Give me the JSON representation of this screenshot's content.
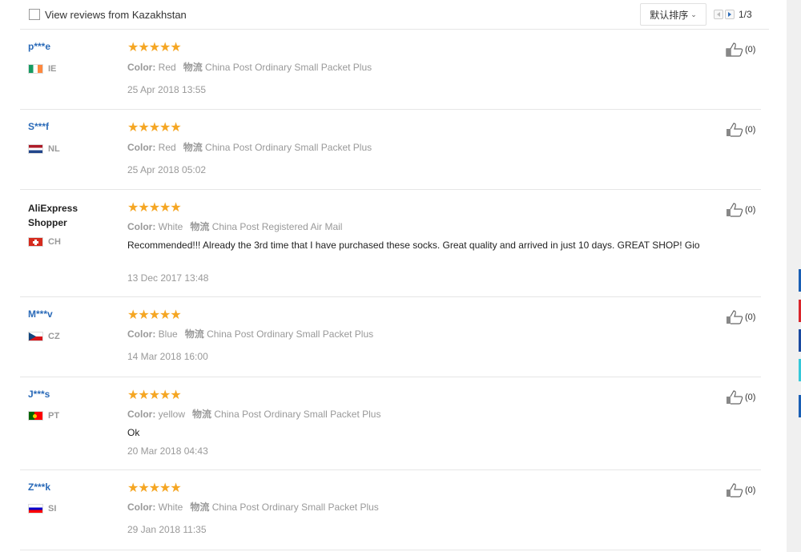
{
  "toolbar": {
    "filter_label": "View reviews from Kazakhstan",
    "sort_label": "默认排序",
    "page": "1/3"
  },
  "labels": {
    "color": "Color:",
    "shipping": "物流"
  },
  "reviews": [
    {
      "user": "p***e",
      "country": "IE",
      "stars": "★★★★★",
      "color": "Red",
      "shipping": "China Post Ordinary Small Packet Plus",
      "text": "",
      "date": "25 Apr 2018 13:55",
      "helpful": "(0)"
    },
    {
      "user": "S***f",
      "country": "NL",
      "stars": "★★★★★",
      "color": "Red",
      "shipping": "China Post Ordinary Small Packet Plus",
      "text": "",
      "date": "25 Apr 2018 05:02",
      "helpful": "(0)"
    },
    {
      "user": "AliExpress Shopper",
      "country": "CH",
      "stars": "★★★★★",
      "color": "White",
      "shipping": "China Post Registered Air Mail",
      "text": "Recommended!!! Already the 3rd time that I have purchased these socks. Great quality and arrived in just 10 days. GREAT SHOP! Gio",
      "date": "13 Dec 2017 13:48",
      "helpful": "(0)"
    },
    {
      "user": "M***v",
      "country": "CZ",
      "stars": "★★★★★",
      "color": "Blue",
      "shipping": "China Post Ordinary Small Packet Plus",
      "text": "",
      "date": "14 Mar 2018 16:00",
      "helpful": "(0)"
    },
    {
      "user": "J***s",
      "country": "PT",
      "stars": "★★★★★",
      "color": "yellow",
      "shipping": "China Post Ordinary Small Packet Plus",
      "text": "Ok",
      "date": "20 Mar 2018 04:43",
      "helpful": "(0)"
    },
    {
      "user": "Z***k",
      "country": "SI",
      "stars": "★★★★★",
      "color": "White",
      "shipping": "China Post Ordinary Small Packet Plus",
      "text": "",
      "date": "29 Jan 2018 11:35",
      "helpful": "(0)"
    }
  ],
  "colors": {
    "link_blue": "#2a6ab8",
    "star_orange": "#f5a623",
    "muted_gray": "#999999",
    "side_tabs": [
      "#1a5fb4",
      "#d9262c",
      "#1a4aa0",
      "#35c8d9",
      "#1a5fb4"
    ]
  }
}
